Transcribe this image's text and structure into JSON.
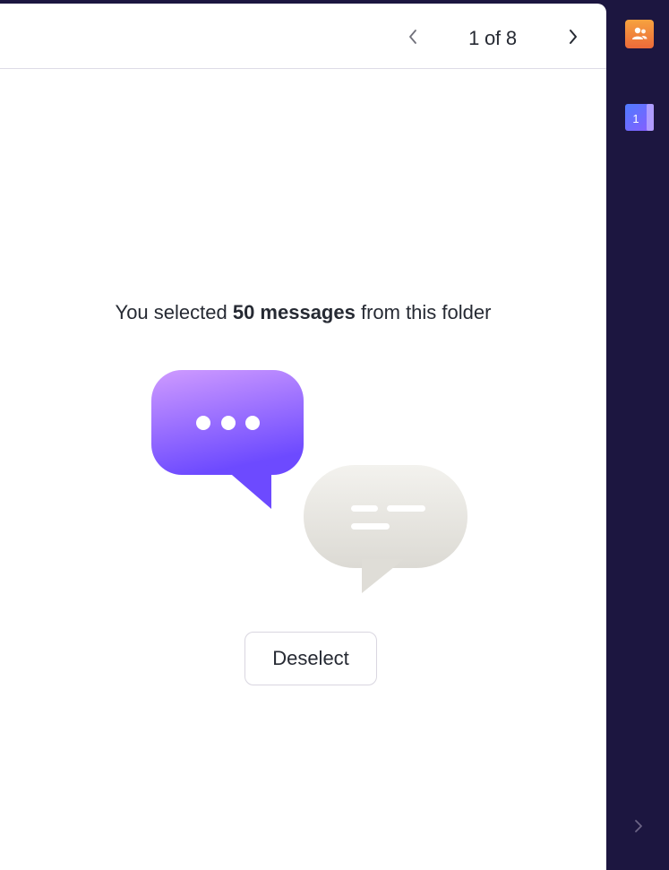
{
  "toolbar": {
    "pager": {
      "current": "1",
      "total": "8",
      "label": "1 of 8"
    },
    "prev_icon": "chevron-left-icon",
    "next_icon": "chevron-right-icon"
  },
  "selection": {
    "prefix": "You selected ",
    "count_label": "50 messages",
    "suffix": " from this folder",
    "illustration": "chat-bubbles-illustration"
  },
  "actions": {
    "deselect_label": "Deselect"
  },
  "rail": {
    "apps": [
      {
        "name": "contacts",
        "icon": "contacts-icon",
        "color": "#f08a3c"
      },
      {
        "name": "calendar",
        "icon": "calendar-icon",
        "badge": "1",
        "color": "#6d4aff"
      }
    ],
    "expand_icon": "chevron-right-icon"
  },
  "colors": {
    "background": "#1c1640",
    "panel": "#ffffff",
    "accent": "#6d4aff",
    "text": "#262a33"
  }
}
